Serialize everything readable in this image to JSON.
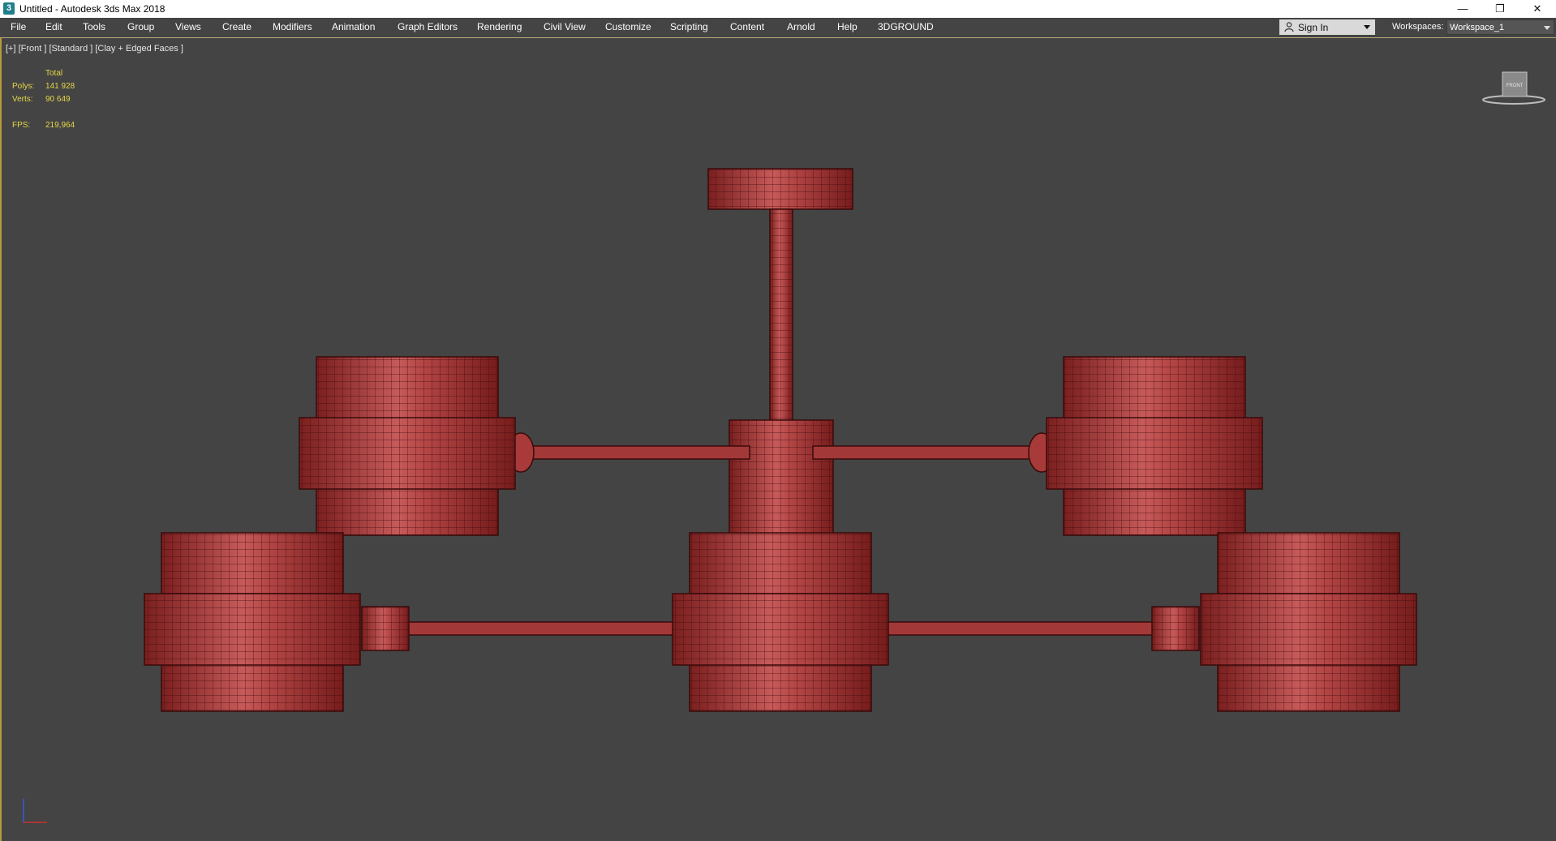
{
  "window": {
    "title": "Untitled - Autodesk 3ds Max 2018",
    "icon": "3ds-max-icon",
    "controls": [
      "minimize",
      "restore",
      "close"
    ]
  },
  "menu": {
    "items": [
      "File",
      "Edit",
      "Tools",
      "Group",
      "Views",
      "Create",
      "Modifiers",
      "Animation",
      "Graph Editors",
      "Rendering",
      "Civil View",
      "Customize",
      "Scripting",
      "Content",
      "Arnold",
      "Help",
      "3DGROUND"
    ],
    "sign_in": "Sign In",
    "workspaces_label": "Workspaces:",
    "workspace_value": "Workspace_1"
  },
  "viewport": {
    "label": "[+] [Front ] [Standard ] [Clay + Edged Faces ]",
    "stats": {
      "total_label": "Total",
      "polys_label": "Polys:",
      "polys_value": "141 928",
      "verts_label": "Verts:",
      "verts_value": "90 649",
      "fps_label": "FPS:",
      "fps_value": "219,964"
    },
    "navcube_label": "FRONT",
    "model_color": "#a83232",
    "stats_color": "#e6d64a",
    "border_accent": "#b79a3a"
  }
}
